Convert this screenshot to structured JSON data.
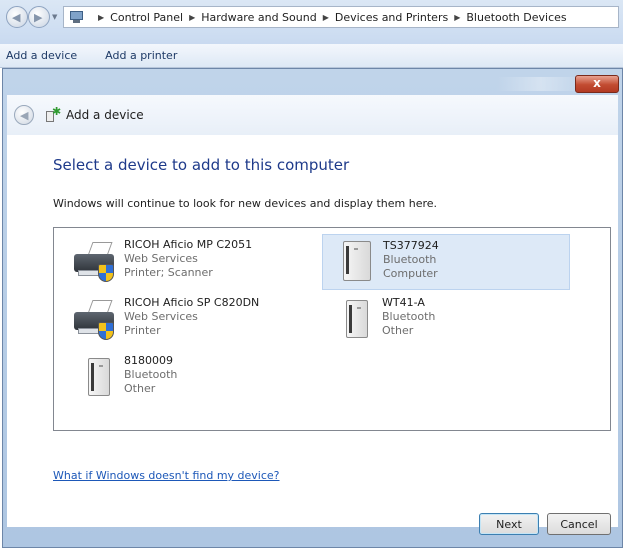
{
  "explorer": {
    "breadcrumb": [
      "Control Panel",
      "Hardware and Sound",
      "Devices and Printers",
      "Bluetooth Devices"
    ],
    "commands": [
      "Add a device",
      "Add a printer"
    ]
  },
  "dialog": {
    "header_title": "Add a device",
    "heading": "Select a device to add to this computer",
    "instruction": "Windows will continue to look for new devices and display them here.",
    "help_link": "What if Windows doesn't find my device?",
    "next_label": "Next",
    "cancel_label": "Cancel",
    "close_glyph": "x"
  },
  "devices": [
    {
      "name": "RICOH Aficio MP C2051",
      "line1": "Web Services",
      "line2": "Printer; Scanner",
      "icon": "printer-icon",
      "selected": false
    },
    {
      "name": "TS377924",
      "line1": "Bluetooth",
      "line2": "Computer",
      "icon": "device-icon",
      "selected": true
    },
    {
      "name": "RICOH Aficio SP C820DN",
      "line1": "Web Services",
      "line2": "Printer",
      "icon": "printer-icon",
      "selected": false
    },
    {
      "name": "WT41-A",
      "line1": "Bluetooth",
      "line2": "Other",
      "icon": "device-icon",
      "selected": false
    },
    {
      "name": "8180009",
      "line1": "Bluetooth",
      "line2": "Other",
      "icon": "device-icon",
      "selected": false
    }
  ]
}
